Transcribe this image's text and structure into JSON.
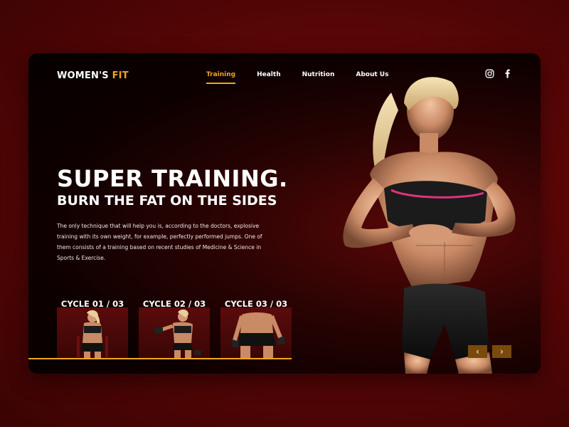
{
  "brand": {
    "name_prefix": "WOMEN'S",
    "name_accent": "FIT",
    "accent_color": "#f2a51a"
  },
  "nav": {
    "items": [
      {
        "label": "Training",
        "active": true
      },
      {
        "label": "Health",
        "active": false
      },
      {
        "label": "Nutrition",
        "active": false
      },
      {
        "label": "About Us",
        "active": false
      }
    ]
  },
  "social": {
    "icons": [
      "instagram-icon",
      "facebook-icon"
    ]
  },
  "hero": {
    "title": "SUPER TRAINING.",
    "subtitle": "BURN THE FAT ON THE SIDES",
    "description": "The only technique that will help you is, according to the doctors, explosive training with its own weight, for example, perfectly performed jumps. One of them consists of a training based on recent studies of Medicine & Science in Sports & Exercise."
  },
  "cycles": [
    {
      "label": "CYCLE 01 / 03"
    },
    {
      "label": "CYCLE 02 / 03"
    },
    {
      "label": "CYCLE 03 / 03"
    }
  ],
  "slider": {
    "prev_icon": "chevron-left-icon",
    "next_icon": "chevron-right-icon",
    "prev_glyph": "‹",
    "next_glyph": "›"
  }
}
